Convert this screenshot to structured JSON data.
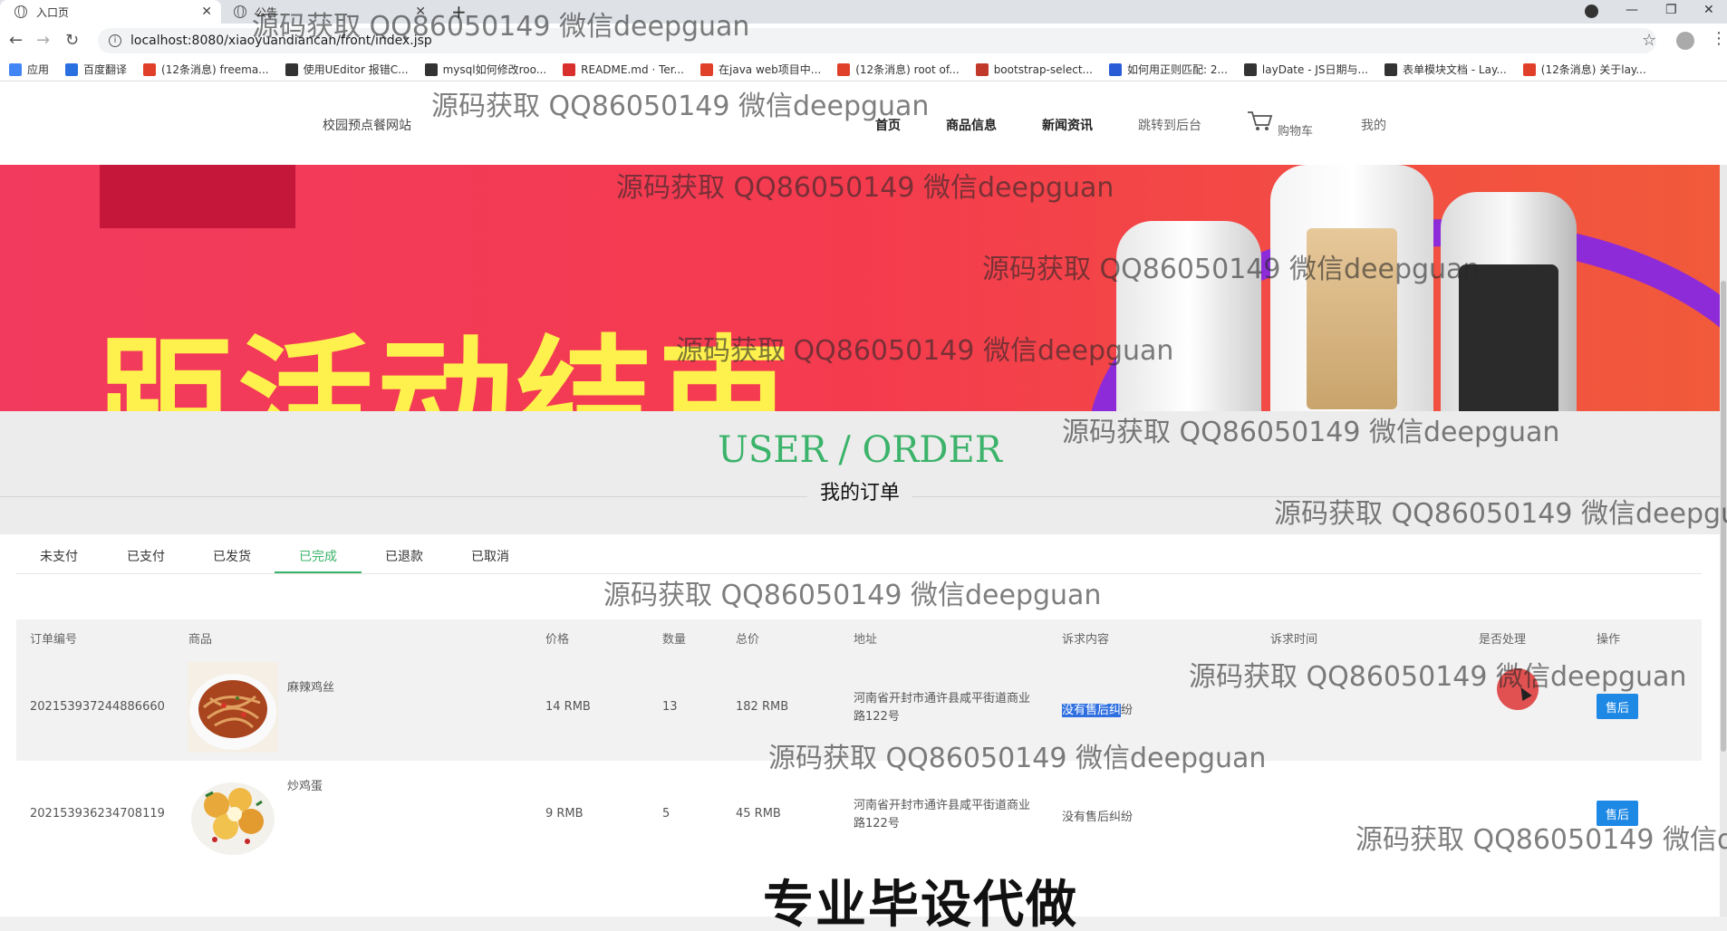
{
  "browser": {
    "active_tab": "入口页",
    "inactive_tab": "公告",
    "url": "localhost:8080/xiaoyuandiancan/front/index.jsp",
    "bookmarks": [
      {
        "label": "应用",
        "color": "#4285f4"
      },
      {
        "label": "百度翻译",
        "color": "#2a6fe0"
      },
      {
        "label": "(12条消息) freema...",
        "color": "#e0402a"
      },
      {
        "label": "使用UEditor 报错C...",
        "color": "#333333"
      },
      {
        "label": "mysql如何修改roo...",
        "color": "#333333"
      },
      {
        "label": "README.md · Ter...",
        "color": "#d9302e"
      },
      {
        "label": "在java web项目中...",
        "color": "#e0402a"
      },
      {
        "label": "(12条消息) root of...",
        "color": "#e0402a"
      },
      {
        "label": "bootstrap-select...",
        "color": "#c0392b"
      },
      {
        "label": "如何用正则匹配: 2...",
        "color": "#2a5bd7"
      },
      {
        "label": "layDate - JS日期与...",
        "color": "#333333"
      },
      {
        "label": "表单模块文档 - Lay...",
        "color": "#333333"
      },
      {
        "label": "(12条消息) 关于lay...",
        "color": "#e0402a"
      }
    ]
  },
  "site": {
    "name": "校园预点餐网站",
    "nav": {
      "home": "首页",
      "products": "商品信息",
      "news": "新闻资讯",
      "backend": "跳转到后台",
      "cart": "购物车",
      "mine": "我的"
    }
  },
  "section": {
    "title_en": "USER / ORDER",
    "title_zh": "我的订单"
  },
  "order_tabs": [
    "未支付",
    "已支付",
    "已发货",
    "已完成",
    "已退款",
    "已取消"
  ],
  "active_order_tab": "已完成",
  "table": {
    "headers": [
      "订单编号",
      "商品",
      "价格",
      "数量",
      "总价",
      "地址",
      "诉求内容",
      "诉求时间",
      "是否处理",
      "操作"
    ],
    "rows": [
      {
        "order_no": "202153937244886660",
        "product": "麻辣鸡丝",
        "price": "14 RMB",
        "qty": "13",
        "total": "182 RMB",
        "address": "河南省开封市通许县咸平街道商业路122号",
        "appeal_selected": "没有售后纠",
        "appeal_rest": "纷",
        "action": "售后"
      },
      {
        "order_no": "202153936234708119",
        "product": "炒鸡蛋",
        "price": "9 RMB",
        "qty": "5",
        "total": "45 RMB",
        "address": "河南省开封市通许县咸平街道商业路122号",
        "appeal": "没有售后纠纷",
        "action": "售后"
      }
    ]
  },
  "watermark": "源码获取 QQ86050149 微信deepguan",
  "promo_text": "专业毕设代做",
  "colors": {
    "accent_green": "#3bb36a",
    "button_blue": "#1e88e5",
    "banner_red": "#f23a5e",
    "banner_yellow": "#fff14d"
  }
}
